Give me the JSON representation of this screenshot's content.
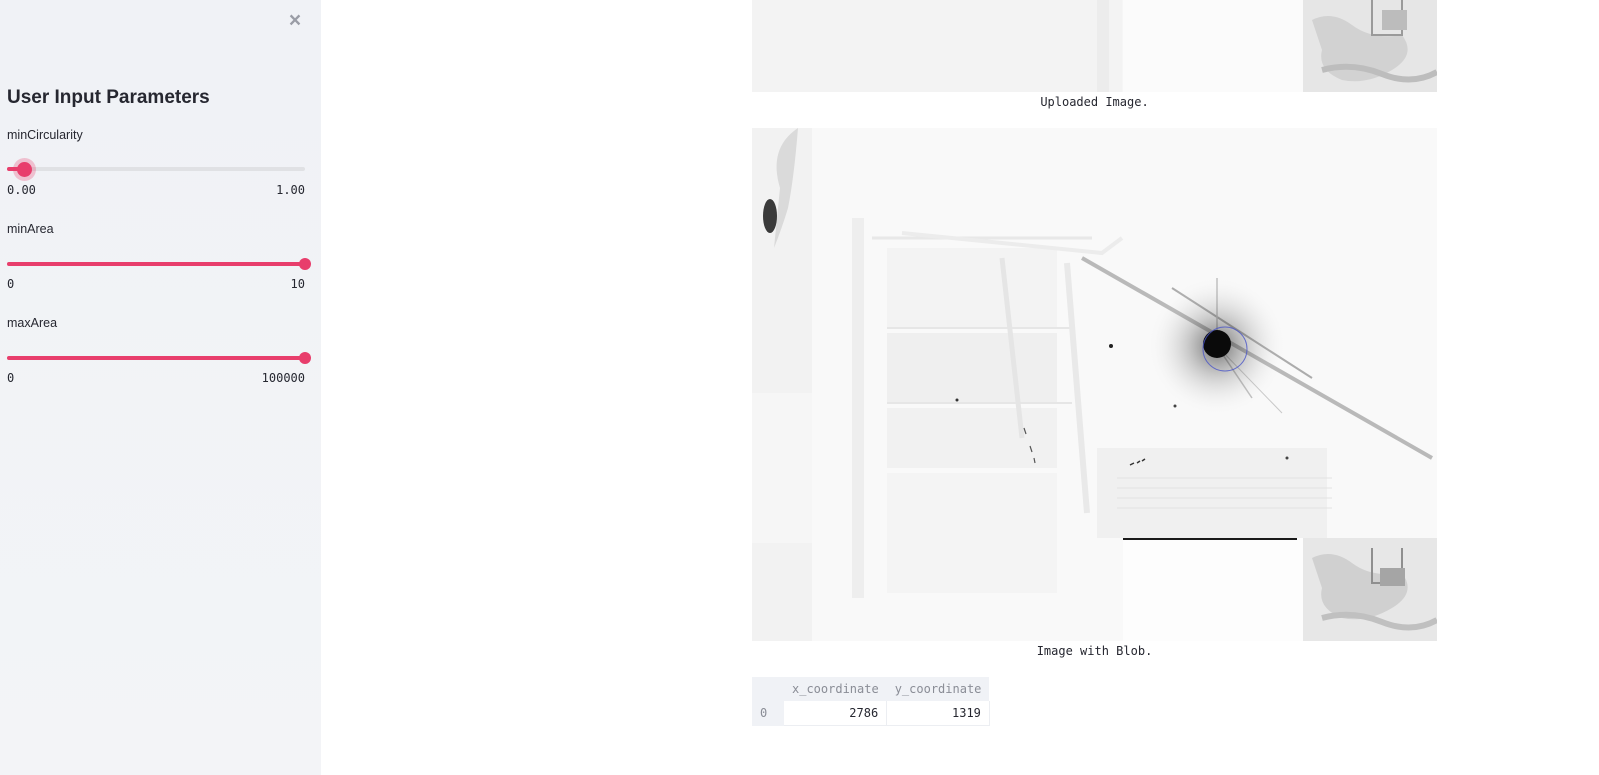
{
  "sidebar": {
    "close_label": "×",
    "title": "User Input Parameters",
    "params": [
      {
        "label": "minCircularity",
        "min": "0.00",
        "max": "1.00",
        "value_fraction": 0.06
      },
      {
        "label": "minArea",
        "min": "0",
        "max": "10",
        "value_fraction": 1.0
      },
      {
        "label": "maxArea",
        "min": "0",
        "max": "100000",
        "value_fraction": 1.0
      }
    ]
  },
  "main": {
    "uploaded_caption": "Uploaded Image.",
    "blob_caption": "Image with Blob.",
    "table": {
      "columns": [
        "x_coordinate",
        "y_coordinate"
      ],
      "rows": [
        {
          "index": "0",
          "x": "2786",
          "y": "1319"
        }
      ]
    }
  },
  "colors": {
    "accent": "#e83e6c",
    "sidebar_bg": "#f0f2f6",
    "text": "#262730"
  },
  "icons": {
    "close": "close-icon"
  }
}
